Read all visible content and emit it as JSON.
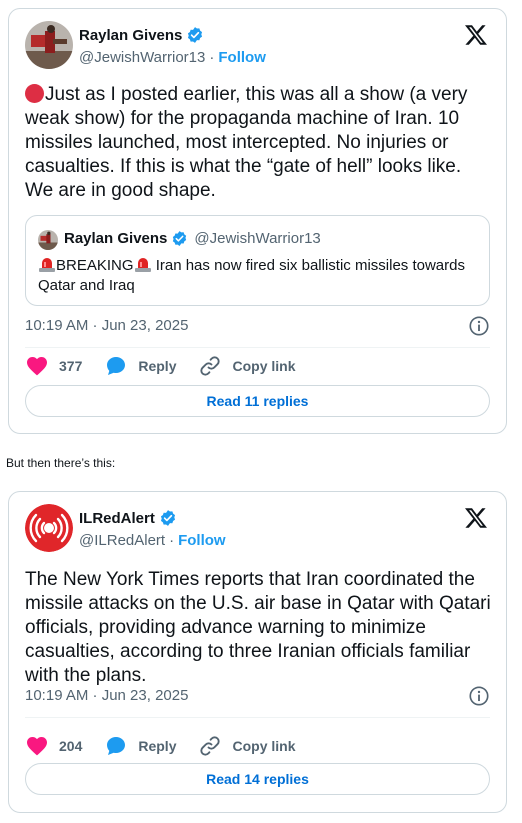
{
  "colors": {
    "accent": "#1d9bf0",
    "heart": "#f91880",
    "text_secondary": "#536471",
    "border": "#cfd9de",
    "alert_red": "#e0262a"
  },
  "tweet1": {
    "author": "Raylan Givens",
    "handle": "@JewishWarrior13",
    "follow_label": "Follow",
    "text": "Just as I posted earlier, this was all a show (a very weak show) for the propaganda machine of Iran. 10 missiles launched, most intercepted. No injuries or casualties. If this is what the “gate of hell” looks like. We are in good shape.",
    "quote": {
      "author": "Raylan Givens",
      "handle": "@JewishWarrior13",
      "breaking": "BREAKING",
      "text": "Iran has now fired six ballistic missiles towards Qatar and Iraq"
    },
    "timestamp": "10:19 AM · Jun 23, 2025",
    "likes": "377",
    "reply_label": "Reply",
    "copy_link_label": "Copy link",
    "read_replies": "Read 11 replies"
  },
  "between_text": "But then there’s this:",
  "tweet2": {
    "author": "ILRedAlert",
    "handle": "@ILRedAlert",
    "follow_label": "Follow",
    "text": "The New York Times reports that Iran coordinated the missile attacks on the U.S. air base in Qatar with Qatari officials, providing advance warning to minimize casualties, according to three Iranian officials familiar with the plans.",
    "timestamp": "10:19 AM · Jun 23, 2025",
    "likes": "204",
    "reply_label": "Reply",
    "copy_link_label": "Copy link",
    "read_replies": "Read 14 replies"
  },
  "separator": "·"
}
